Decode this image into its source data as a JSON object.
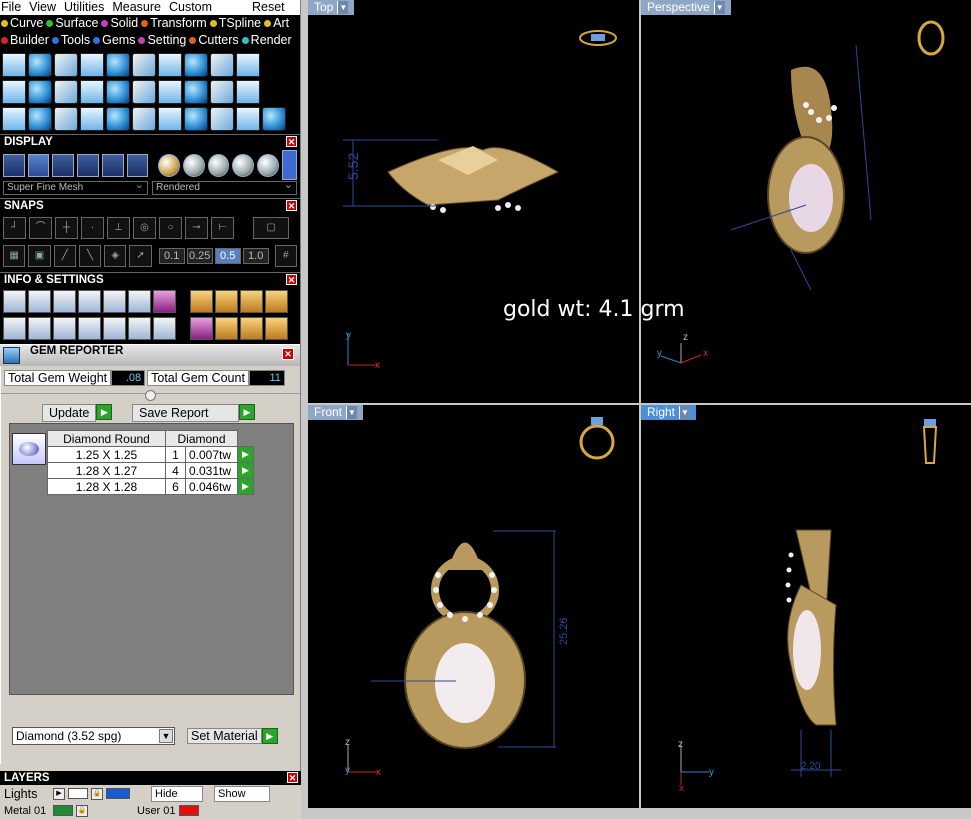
{
  "menubar": [
    "File",
    "View",
    "Utilities",
    "Measure",
    "Custom"
  ],
  "menubar_reset": "Reset",
  "tabs_row1": [
    {
      "label": "Curve",
      "color": "#e0c020"
    },
    {
      "label": "Surface",
      "color": "#30c030"
    },
    {
      "label": "Solid",
      "color": "#c040c0"
    },
    {
      "label": "Transform",
      "color": "#e06020"
    },
    {
      "label": "TSpline",
      "color": "#e0c020"
    },
    {
      "label": "Art",
      "color": "#e0c020"
    }
  ],
  "tabs_row2": [
    {
      "label": "Builder",
      "color": "#e02020"
    },
    {
      "label": "Tools",
      "color": "#3070e0"
    },
    {
      "label": "Gems",
      "color": "#3070e0"
    },
    {
      "label": "Setting",
      "color": "#c040c0"
    },
    {
      "label": "Cutters",
      "color": "#e06020"
    },
    {
      "label": "Render",
      "color": "#30c0c0"
    }
  ],
  "sections": {
    "display": "DISPLAY",
    "snaps": "SNAPS",
    "info": "INFO & SETTINGS",
    "layers": "LAYERS"
  },
  "display": {
    "mesh": "Super Fine Mesh",
    "render_mode": "Rendered"
  },
  "snaps": {
    "increments": [
      "0.1",
      "0.25",
      "0.5",
      "1.0"
    ],
    "active_increment": "0.5"
  },
  "gem_reporter": {
    "title": "GEM REPORTER",
    "total_weight_label": "Total Gem Weight",
    "total_weight": ".08",
    "total_count_label": "Total Gem Count",
    "total_count": "11",
    "update_label": "Update",
    "save_label": "Save Report",
    "col_shape": "Diamond Round",
    "col_material": "Diamond",
    "rows": [
      {
        "size": "1.25 X 1.25",
        "count": "1",
        "weight": "0.007tw"
      },
      {
        "size": "1.28 X 1.27",
        "count": "4",
        "weight": "0.031tw"
      },
      {
        "size": "1.28 X 1.28",
        "count": "6",
        "weight": "0.046tw"
      }
    ],
    "material": "Diamond    (3.52 spg)",
    "set_material_label": "Set Material"
  },
  "layers": {
    "lights_label": "Lights",
    "hide_label": "Hide",
    "show_label": "Show",
    "row2_left": "Metal 01",
    "row2_right": "User 01"
  },
  "viewports": {
    "top": "Top",
    "perspective": "Perspective",
    "front": "Front",
    "right": "Right"
  },
  "dimensions": {
    "top_height": "5.52",
    "front_height": "25.26",
    "right_width": "2.20"
  },
  "overlay_text": "gold wt: 4.1 grm"
}
